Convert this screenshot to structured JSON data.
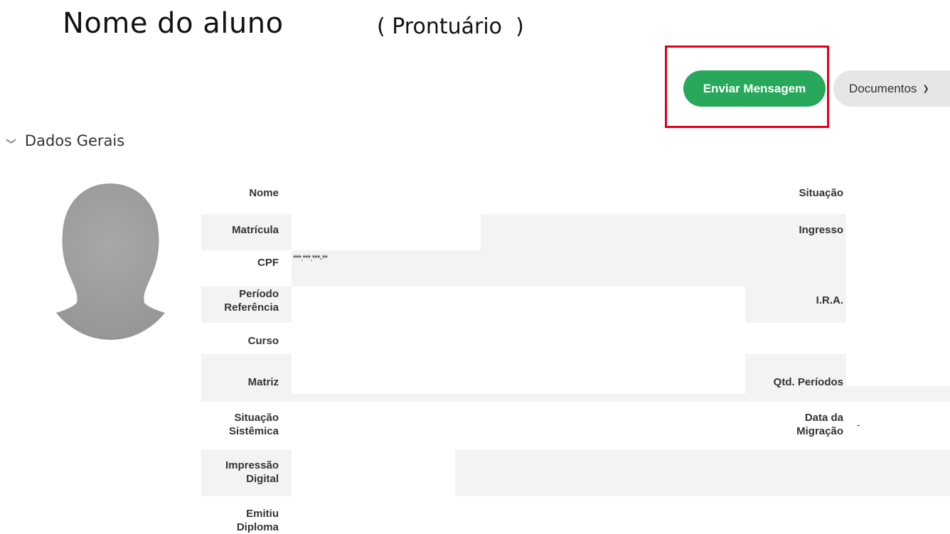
{
  "page": {
    "title": "Nome do aluno",
    "subtitle": "( Prontuário  )"
  },
  "actions": {
    "send_message": "Enviar Mensagem",
    "documents": "Documentos"
  },
  "section": {
    "title": "Dados Gerais"
  },
  "fields_left": {
    "nome": "Nome",
    "matricula": "Matrícula",
    "cpf": "CPF",
    "cpf_value": "***.***.***-**",
    "periodo_line1": "Período",
    "periodo_line2": "Referência",
    "curso": "Curso",
    "matriz": "Matriz",
    "situacao_sist_line1": "Situação",
    "situacao_sist_line2": "Sistêmica",
    "impressao_line1": "Impressão",
    "impressao_line2": "Digital",
    "emitiu_line1": "Emitiu",
    "emitiu_line2": "Diploma"
  },
  "fields_right": {
    "situacao": "Situação",
    "ingresso": "Ingresso",
    "ira": "I.R.A.",
    "qtd_periodos": "Qtd. Períodos",
    "data_migracao_line1": "Data da",
    "data_migracao_line2": "Migração",
    "data_migracao_value": "-"
  },
  "icons": {
    "section_toggle": "chevron-down-icon",
    "documents_dropdown": "chevron-down-icon",
    "avatar": "user-silhouette-icon"
  },
  "colors": {
    "send_button": "#27a85a",
    "highlight": "#e4001b",
    "documents_button": "#e6e6e6",
    "row_shade": "#f3f3f3"
  }
}
